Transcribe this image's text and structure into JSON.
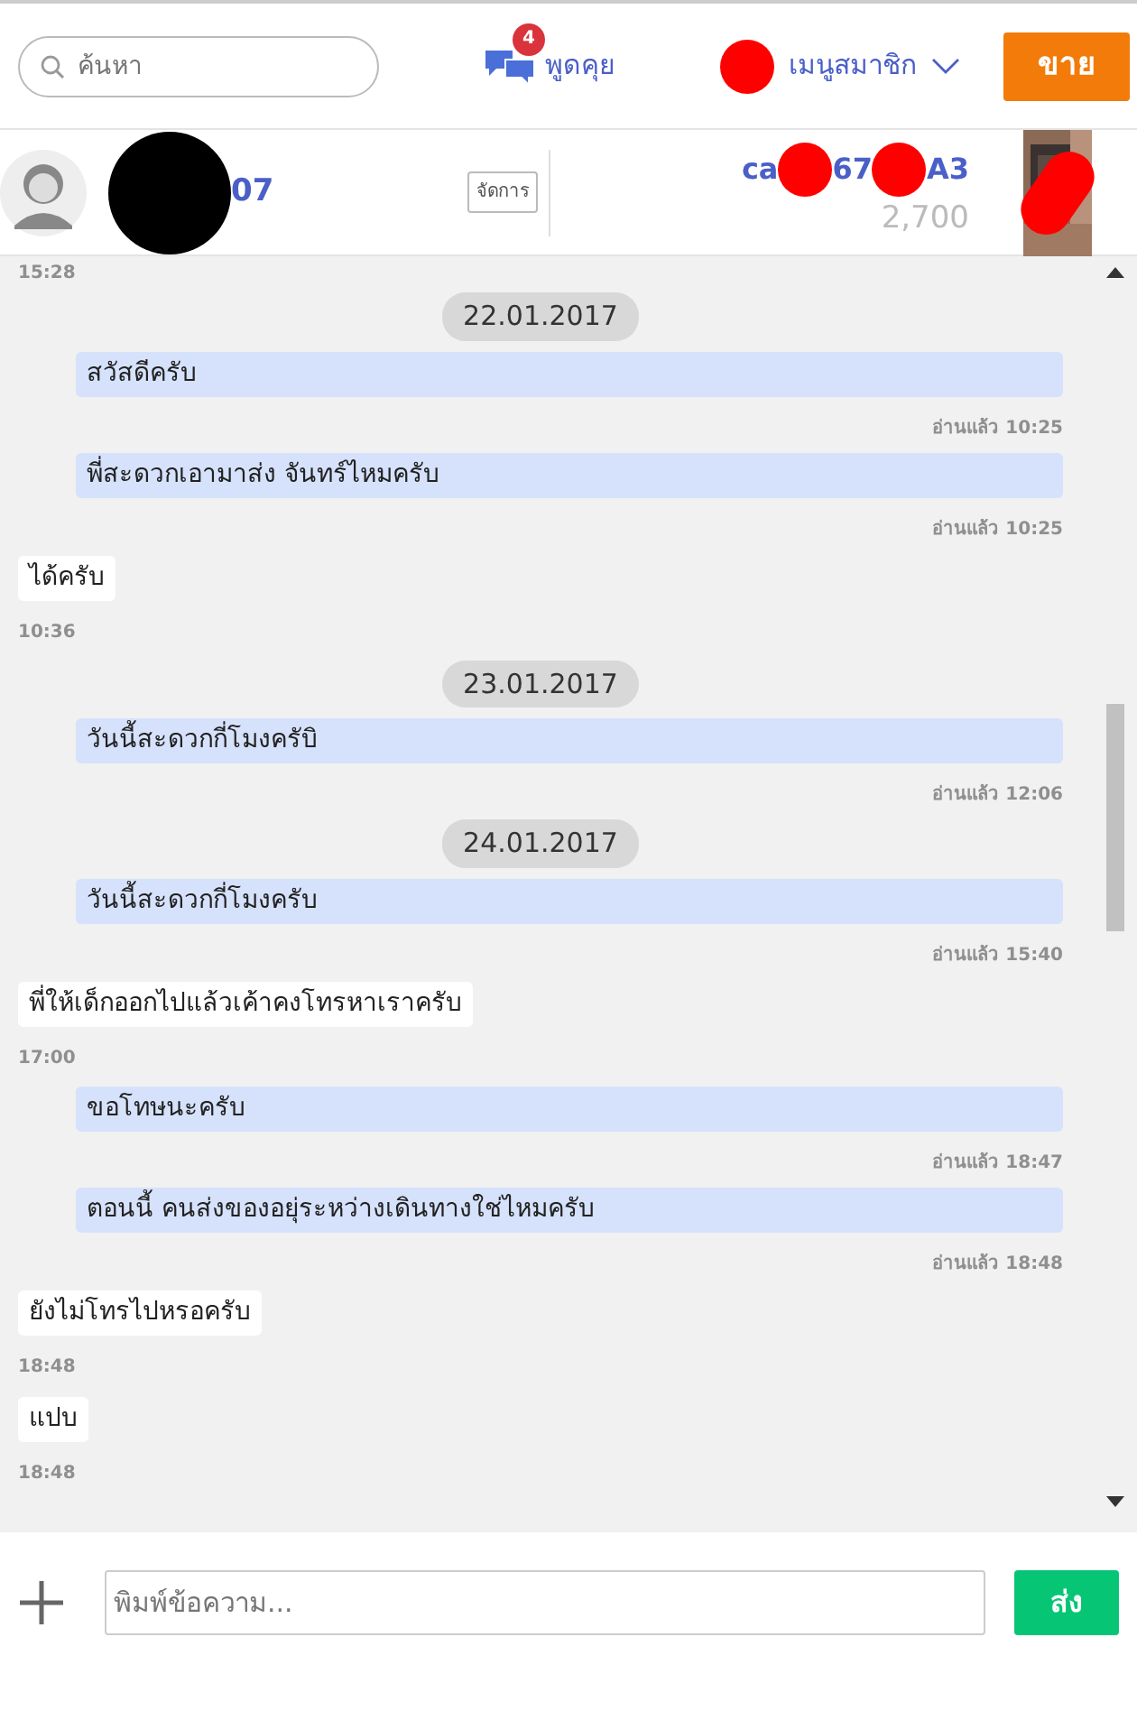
{
  "header": {
    "search": {
      "placeholder": "ค้นหา"
    },
    "chat": {
      "label": "พูดคุย",
      "badge": "4"
    },
    "member_menu": {
      "label": "เมนูสมาชิก"
    },
    "sell_button": "ขาย"
  },
  "conversation": {
    "user_name": "07",
    "manage_button": "จัดการ",
    "product_title_parts": [
      "ca",
      "67",
      "A3"
    ],
    "product_price": "2,700"
  },
  "messages": [
    {
      "kind": "time_only",
      "time": "15:28"
    },
    {
      "kind": "date",
      "text": "22.01.2017"
    },
    {
      "kind": "sent",
      "text": "สวัสดีครับ",
      "status": "อ่านแล้ว 10:25"
    },
    {
      "kind": "sent",
      "text": "พี่สะดวกเอามาส่ง จันทร์ไหมครับ",
      "status": "อ่านแล้ว 10:25"
    },
    {
      "kind": "received",
      "text": "ได้ครับ",
      "time": "10:36"
    },
    {
      "kind": "date",
      "text": "23.01.2017"
    },
    {
      "kind": "sent",
      "text": "วันนี้สะดวกกี่โมงครับิ",
      "status": "อ่านแล้ว 12:06"
    },
    {
      "kind": "date",
      "text": "24.01.2017"
    },
    {
      "kind": "sent",
      "text": "วันนี้สะดวกกี่โมงครับ",
      "status": "อ่านแล้ว 15:40"
    },
    {
      "kind": "received",
      "text": "พี่ให้เด็กออกไปแล้วเค้าคงโทรหาเราครับ",
      "time": "17:00"
    },
    {
      "kind": "sent",
      "text": "ขอโทษนะครับ",
      "status": "อ่านแล้ว 18:47"
    },
    {
      "kind": "sent",
      "text": "ตอนนี้ คนส่งของอยุ่ระหว่างเดินทางใช่ไหมครับ",
      "status": "อ่านแล้ว 18:48"
    },
    {
      "kind": "received",
      "text": "ยังไม่โทรไปหรอครับ",
      "time": "18:48"
    },
    {
      "kind": "received",
      "text": "แปบ",
      "time": "18:48"
    }
  ],
  "composer": {
    "placeholder": "พิมพ์ข้อความ...",
    "send_button": "ส่ง"
  }
}
